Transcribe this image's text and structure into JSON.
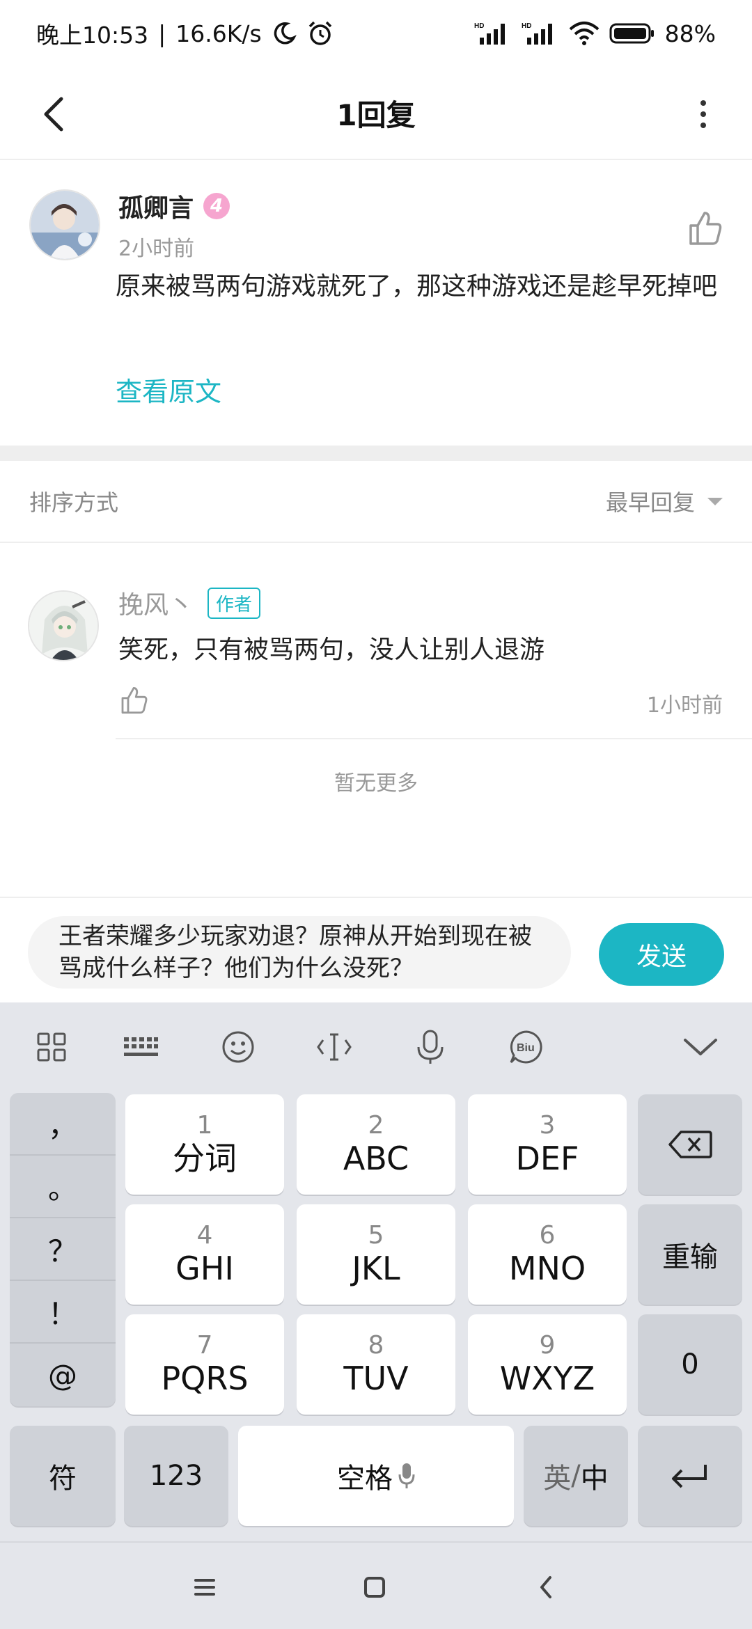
{
  "status_bar": {
    "time": "晚上10:53",
    "speed": "16.6K/s",
    "battery": "88%",
    "icons": [
      "moon-icon",
      "alarm-icon",
      "signal-hd-icon",
      "signal-hd-icon-2",
      "wifi-icon",
      "battery-icon"
    ]
  },
  "header": {
    "title": "1回复",
    "back_icon": "chevron-left-icon",
    "more_icon": "more-vertical-icon"
  },
  "original": {
    "username": "孤卿言",
    "level": "4",
    "time": "2小时前",
    "text": "原来被骂两句游戏就死了，那这种游戏还是趁早死掉吧",
    "view_original": "查看原文"
  },
  "sort": {
    "label": "排序方式",
    "selected": "最早回复"
  },
  "replies": [
    {
      "username": "挽风丶",
      "tag": "作者",
      "text": "笑死，只有被骂两句，没人让别人退游",
      "time": "1小时前"
    }
  ],
  "no_more": "暂无更多",
  "composer": {
    "text": "王者荣耀多少玩家劝退？原神从开始到现在被骂成什么样子？他们为什么没死？",
    "send_label": "发送"
  },
  "keyboard": {
    "toolbar_icons": [
      "grid-icon",
      "keyboard-icon",
      "emoji-icon",
      "cursor-icon",
      "microphone-icon",
      "biu-icon",
      "collapse-icon"
    ],
    "punctuation": [
      "，",
      "。",
      "？",
      "！",
      "@"
    ],
    "keys": [
      {
        "num": "1",
        "label": "分词"
      },
      {
        "num": "2",
        "label": "ABC"
      },
      {
        "num": "3",
        "label": "DEF"
      },
      {
        "num": "4",
        "label": "GHI"
      },
      {
        "num": "5",
        "label": "JKL"
      },
      {
        "num": "6",
        "label": "MNO"
      },
      {
        "num": "7",
        "label": "PQRS"
      },
      {
        "num": "8",
        "label": "TUV"
      },
      {
        "num": "9",
        "label": "WXYZ"
      }
    ],
    "reinput_label": "重输",
    "zero_label": "0",
    "symbol_label": "符",
    "num_label": "123",
    "space_label": "空格",
    "lang_en": "英",
    "lang_slash": "/",
    "lang_zh": "中"
  },
  "colors": {
    "accent": "#1cb6c4",
    "level_badge": "#f6a5cf"
  }
}
